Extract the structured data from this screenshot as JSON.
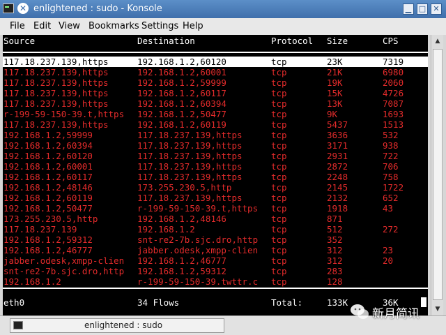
{
  "window": {
    "title": "enlightened : sudo - Konsole",
    "menu_glyph": "✕",
    "buttons": {
      "minimize": "▁",
      "maximize": "□",
      "close": "✕"
    }
  },
  "menubar": {
    "items": [
      "File",
      "Edit",
      "View",
      "Bookmarks",
      "Settings",
      "Help"
    ]
  },
  "terminal": {
    "headers": {
      "source": "Source",
      "destination": "Destination",
      "protocol": "Protocol",
      "size": "Size",
      "cps": "CPS"
    },
    "selected_row_index": 0,
    "rows": [
      {
        "source": "117.18.237.139,https",
        "destination": "192.168.1.2,60120",
        "protocol": "tcp",
        "size": "23K",
        "cps": "7319"
      },
      {
        "source": "117.18.237.139,https",
        "destination": "192.168.1.2,60001",
        "protocol": "tcp",
        "size": "21K",
        "cps": "6980"
      },
      {
        "source": "117.18.237.139,https",
        "destination": "192.168.1.2,59999",
        "protocol": "tcp",
        "size": "19K",
        "cps": "2060"
      },
      {
        "source": "117.18.237.139,https",
        "destination": "192.168.1.2,60117",
        "protocol": "tcp",
        "size": "15K",
        "cps": "4726"
      },
      {
        "source": "117.18.237.139,https",
        "destination": "192.168.1.2,60394",
        "protocol": "tcp",
        "size": "13K",
        "cps": "7087"
      },
      {
        "source": "r-199-59-150-39.t,https",
        "destination": "192.168.1.2,50477",
        "protocol": "tcp",
        "size": "9K",
        "cps": "1693"
      },
      {
        "source": "117.18.237.139,https",
        "destination": "192.168.1.2,60119",
        "protocol": "tcp",
        "size": "5437",
        "cps": "1513"
      },
      {
        "source": "192.168.1.2,59999",
        "destination": "117.18.237.139,https",
        "protocol": "tcp",
        "size": "3636",
        "cps": "532"
      },
      {
        "source": "192.168.1.2,60394",
        "destination": "117.18.237.139,https",
        "protocol": "tcp",
        "size": "3171",
        "cps": "938"
      },
      {
        "source": "192.168.1.2,60120",
        "destination": "117.18.237.139,https",
        "protocol": "tcp",
        "size": "2931",
        "cps": "722"
      },
      {
        "source": "192.168.1.2,60001",
        "destination": "117.18.237.139,https",
        "protocol": "tcp",
        "size": "2872",
        "cps": "706"
      },
      {
        "source": "192.168.1.2,60117",
        "destination": "117.18.237.139,https",
        "protocol": "tcp",
        "size": "2248",
        "cps": "758"
      },
      {
        "source": "192.168.1.2,48146",
        "destination": "173.255.230.5,http",
        "protocol": "tcp",
        "size": "2145",
        "cps": "1722"
      },
      {
        "source": "192.168.1.2,60119",
        "destination": "117.18.237.139,https",
        "protocol": "tcp",
        "size": "2132",
        "cps": "652"
      },
      {
        "source": "192.168.1.2,50477",
        "destination": "r-199-59-150-39.t,https",
        "protocol": "tcp",
        "size": "1918",
        "cps": "43"
      },
      {
        "source": "173.255.230.5,http",
        "destination": "192.168.1.2,48146",
        "protocol": "tcp",
        "size": "871",
        "cps": ""
      },
      {
        "source": "117.18.237.139",
        "destination": "192.168.1.2",
        "protocol": "tcp",
        "size": "512",
        "cps": "272"
      },
      {
        "source": "192.168.1.2,59312",
        "destination": "snt-re2-7b.sjc.dro,http",
        "protocol": "tcp",
        "size": "352",
        "cps": ""
      },
      {
        "source": "192.168.1.2,46777",
        "destination": "jabber.odesk,xmpp-clien",
        "protocol": "tcp",
        "size": "312",
        "cps": "23"
      },
      {
        "source": "jabber.odesk,xmpp-clien",
        "destination": "192.168.1.2,46777",
        "protocol": "tcp",
        "size": "312",
        "cps": "20"
      },
      {
        "source": "snt-re2-7b.sjc.dro,http",
        "destination": "192.168.1.2,59312",
        "protocol": "tcp",
        "size": "283",
        "cps": ""
      },
      {
        "source": "192.168.1.2",
        "destination": "r-199-59-150-39.twttr.c",
        "protocol": "tcp",
        "size": "128",
        "cps": ""
      }
    ],
    "footer": {
      "interface": "eth0",
      "flows": "34 Flows",
      "total_label": "Total:",
      "total_size": "133K",
      "total_cps": "36K"
    },
    "colors": {
      "background": "#000000",
      "header_text": "#ffffff",
      "row_text": "#e32b2b",
      "selected_bg": "#ffffff",
      "selected_text": "#000000"
    }
  },
  "taskbar": {
    "task_label": "enlightened : sudo"
  },
  "watermark": {
    "text": "新月简讯"
  }
}
